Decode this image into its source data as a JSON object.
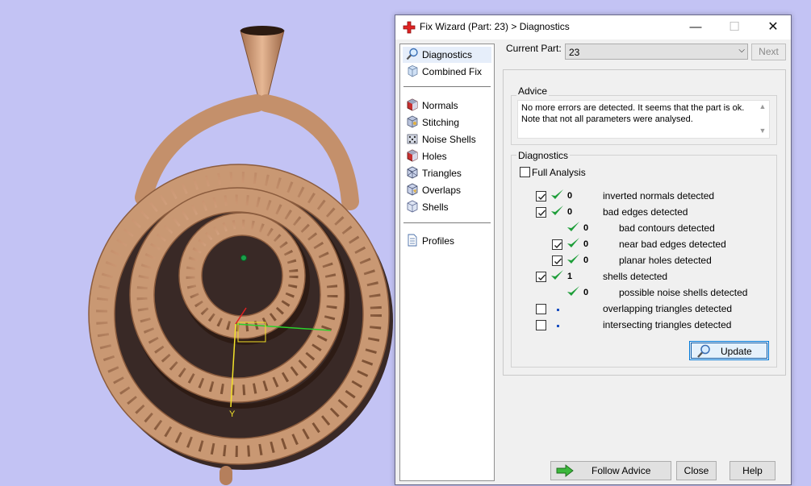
{
  "window": {
    "title": "Fix Wizard (Part: 23) > Diagnostics"
  },
  "nav": {
    "items": [
      {
        "label": "Diagnostics",
        "icon": "magnifier-icon",
        "selected": true
      },
      {
        "label": "Combined Fix",
        "icon": "cube-icon"
      },
      {
        "label": "Normals",
        "icon": "cube-icon"
      },
      {
        "label": "Stitching",
        "icon": "cube-icon"
      },
      {
        "label": "Noise Shells",
        "icon": "dice-icon"
      },
      {
        "label": "Holes",
        "icon": "cube-icon"
      },
      {
        "label": "Triangles",
        "icon": "cube-icon"
      },
      {
        "label": "Overlaps",
        "icon": "cube-icon"
      },
      {
        "label": "Shells",
        "icon": "cube-icon"
      },
      {
        "label": "Profiles",
        "icon": "document-icon"
      }
    ]
  },
  "current_part": {
    "label": "Current Part:",
    "value": "23",
    "next_label": "Next"
  },
  "advice": {
    "title": "Advice",
    "line1": "No more errors are detected. It seems that the part is ok.",
    "line2": "Note that not all parameters were analysed."
  },
  "diagnostics": {
    "title": "Diagnostics",
    "full_analysis": "Full Analysis",
    "rows": [
      {
        "count": "0",
        "label": "inverted normals detected"
      },
      {
        "count": "0",
        "label": "bad edges detected"
      },
      {
        "count": "0",
        "label": "bad contours detected"
      },
      {
        "count": "0",
        "label": "near bad edges detected"
      },
      {
        "count": "0",
        "label": "planar holes detected"
      },
      {
        "count": "1",
        "label": "shells detected"
      },
      {
        "count": "0",
        "label": "possible noise shells detected"
      },
      {
        "count": "",
        "label": "overlapping triangles detected"
      },
      {
        "count": "",
        "label": "intersecting triangles detected"
      }
    ],
    "update_label": "Update"
  },
  "buttons": {
    "follow_advice": "Follow Advice",
    "close": "Close",
    "help": "Help"
  },
  "viewport": {
    "axis_labels": [
      "Y"
    ]
  },
  "colors": {
    "background": "#c3c3f4",
    "model": "#d8a57c",
    "check": "#1e9e3a"
  }
}
